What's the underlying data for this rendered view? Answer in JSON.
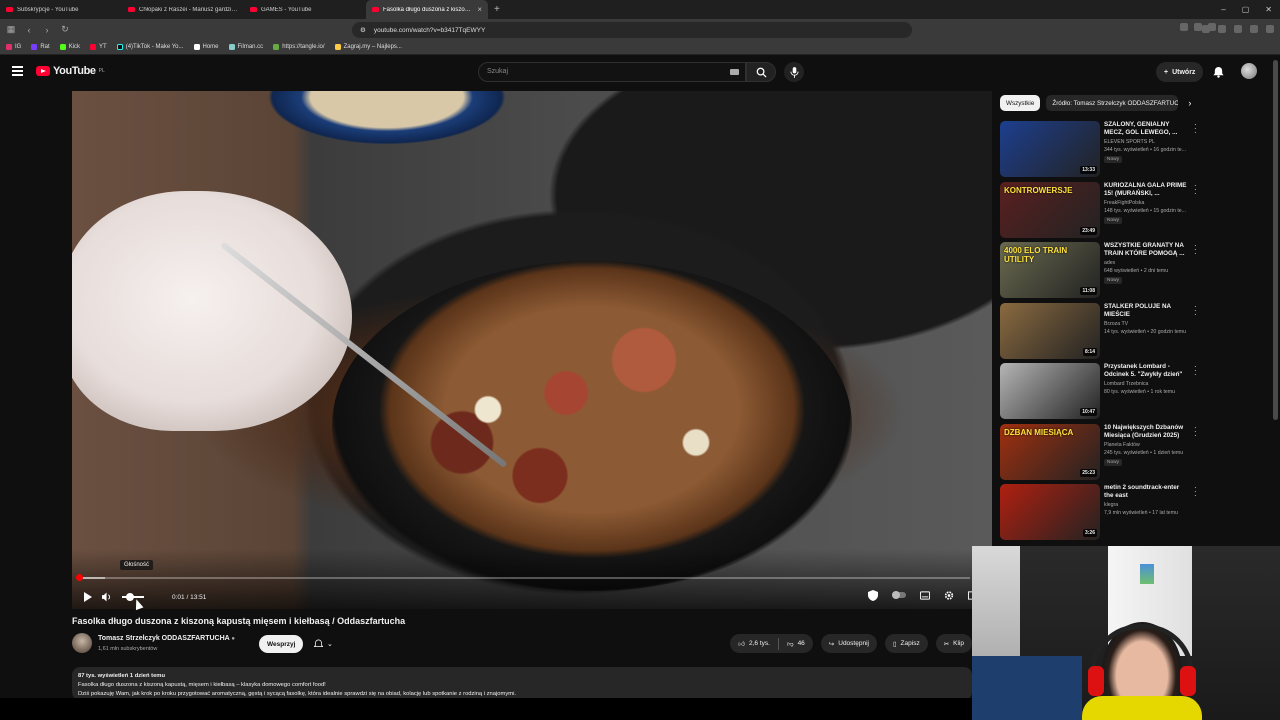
{
  "browser": {
    "tabs": [
      {
        "label": "Subskrypcje - YouTube",
        "active": false
      },
      {
        "label": "Chłopaki z Raszei - Mariusz gardzi p...",
        "active": false
      },
      {
        "label": "GAMES - YouTube",
        "active": false
      },
      {
        "label": "Fasolka długo duszona z kiszoną...",
        "active": true
      }
    ],
    "url": "youtube.com/watch?v=b3417TqEWYY",
    "bookmarks": [
      "IG",
      "Rat",
      "Kick",
      "YT",
      "(4)TikTok - Make Yo...",
      "Home",
      "Filman.cc",
      "https://tangle.io/",
      "Zagraj.my – Najleps..."
    ]
  },
  "header": {
    "logo": "YouTube",
    "region": "PL",
    "search_placeholder": "Szukaj",
    "create_label": "Utwórz"
  },
  "player": {
    "time_current": "0:01",
    "time_total": "13:51",
    "progress_fraction": 0.0012,
    "buffer_fraction": 0.03,
    "volume_tooltip": "Głośność"
  },
  "video": {
    "title": "Fasolka długo duszona z kiszoną kapustą mięsem i kiełbasą / Oddaszfartucha",
    "channel": "Tomasz Strzelczyk ODDASZFARTUCHA",
    "subscribers": "1,61 mln subskrybentów",
    "support_label": "Wesprzyj",
    "likes": "2,6 tys.",
    "dislikes": "46",
    "share_label": "Udostępnij",
    "save_label": "Zapisz",
    "clip_label": "Klip",
    "desc_meta": "87 tys. wyświetleń  1 dzień temu",
    "desc_line1": "Fasolka długo duszona z kiszoną kapustą, mięsem i kiełbasą – klasyka domowego comfort food!",
    "desc_line2": "Dziś pokazuję Wam, jak krok po kroku przygotować aromatyczną, gęstą i sycącą fasolkę, która idealnie sprawdzi się na obiad, kolację lub spotkanie z rodziną i znajomymi."
  },
  "sidebar": {
    "chips": [
      "Wszystkie",
      "Źródło: Tomasz Strzelczyk ODDASZFARTUCHA"
    ],
    "items": [
      {
        "title": "SZALONY, GENIALNY MECZ, GOL LEWEGO, ...",
        "channel": "ELEVEN SPORTS PL",
        "stats": "344 tys. wyświetleń • 16 godzin te...",
        "badge": "Nowy",
        "duration": "13:33",
        "color": "#1d3f8f"
      },
      {
        "title": "KURIOZALNA GALA PRIME 15! (MURAŃSKI, ...",
        "channel": "FreakFightPolska",
        "stats": "148 tys. wyświetleń • 15 godzin te...",
        "badge": "Nowy",
        "duration": "23:49",
        "color": "#5a2020"
      },
      {
        "title": "WSZYSTKIE GRANATY NA TRAIN KTÓRE POMOGĄ ...",
        "channel": "adex",
        "stats": "648 wyświetleń • 2 dni temu",
        "badge": "Nowy",
        "duration": "11:08",
        "color": "#6a6a50"
      },
      {
        "title": "STALKER POLUJE NA MIEŚCIE",
        "channel": "Brzoza TV",
        "stats": "14 tys. wyświetleń • 20 godzin temu",
        "badge": "",
        "duration": "8:14",
        "color": "#8a6a40"
      },
      {
        "title": "Przystanek Lombard - Odcinek 5. \"Zwykły dzień\"",
        "channel": "Lombard Trzebnica",
        "stats": "80 tys. wyświetleń • 1 rok temu",
        "badge": "",
        "duration": "10:47",
        "color": "#b5b5b5"
      },
      {
        "title": "10 Największych Dzbanów Miesiąca (Grudzień 2025)",
        "channel": "Planeta Faktów",
        "stats": "245 tys. wyświetleń • 1 dzień temu",
        "badge": "Nowy",
        "duration": "25:23",
        "color": "#a03010"
      },
      {
        "title": "metin 2 soundtrack-enter the east",
        "channel": "klegra",
        "stats": "7,9 mln wyświetleń • 17 lat temu",
        "badge": "",
        "duration": "3:26",
        "color": "#b02010"
      }
    ],
    "thumb_texts": [
      "",
      "KONTROWERSJE",
      "4000 ELO TRAIN UTILITY",
      "",
      "",
      "DZBAN MIESIĄCA",
      ""
    ]
  }
}
